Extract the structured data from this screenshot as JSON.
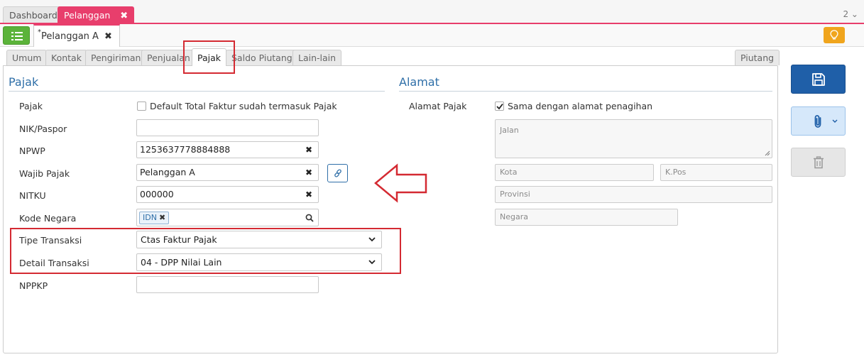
{
  "top_tabs": {
    "dashboard": "Dashboard",
    "pelanggan": "Pelanggan",
    "close_glyph": "✖",
    "counter": "2 ⌄"
  },
  "record_tab": {
    "dirty_mark": "*",
    "label": "Pelanggan A",
    "close_glyph": "✖"
  },
  "section_tabs": [
    "Umum",
    "Kontak",
    "Pengiriman",
    "Penjualan",
    "Pajak",
    "Saldo Piutang",
    "Lain-lain"
  ],
  "side_tab": "Piutang",
  "pajak": {
    "heading": "Pajak",
    "labels": {
      "pajak": "Pajak",
      "nik": "NIK/Paspor",
      "npwp": "NPWP",
      "wajib_pajak": "Wajib Pajak",
      "nitku": "NITKU",
      "kode_negara": "Kode Negara",
      "tipe_transaksi": "Tipe Transaksi",
      "detail_transaksi": "Detail Transaksi",
      "nppkp": "NPPKP"
    },
    "default_total_checkbox": {
      "label": "Default Total Faktur sudah termasuk Pajak",
      "checked": false
    },
    "nik_value": "",
    "npwp_value": "1253637778884888",
    "wajib_pajak_value": "Pelanggan A",
    "nitku_value": "000000",
    "kode_negara_chip": "IDN",
    "tipe_transaksi_value": "Ctas Faktur Pajak",
    "detail_transaksi_value": "04 - DPP Nilai Lain",
    "nppkp_value": "",
    "clear_glyph": "✖"
  },
  "alamat": {
    "heading": "Alamat",
    "alamat_pajak_label": "Alamat Pajak",
    "same_address_checkbox": {
      "label": "Sama dengan alamat penagihan",
      "checked": true
    },
    "placeholders": {
      "jalan": "Jalan",
      "kota": "Kota",
      "kpos": "K.Pos",
      "provinsi": "Provinsi",
      "negara": "Negara"
    }
  },
  "colors": {
    "accent_pink": "#e83e6c",
    "primary_blue": "#1f5fa8",
    "green": "#5bb33a",
    "annotation_red": "#d42a32",
    "bulb_orange": "#f0a51d"
  },
  "icons": [
    "list-icon",
    "lightbulb-icon",
    "link-icon",
    "search-icon",
    "chevron-down-icon",
    "save-icon",
    "paperclip-icon",
    "trash-icon",
    "arrow-left-annotation"
  ]
}
